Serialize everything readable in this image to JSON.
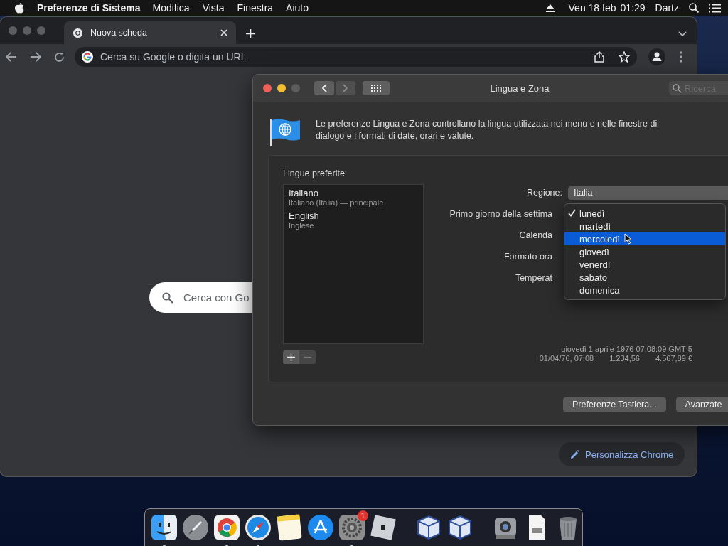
{
  "menu_bar": {
    "app_name": "Preferenze di Sistema",
    "menus": [
      "Modifica",
      "Vista",
      "Finestra",
      "Aiuto"
    ],
    "date": "Ven 18 feb",
    "time": "01:29",
    "user": "Dartz"
  },
  "browser": {
    "tab": {
      "title": "Nuova scheda"
    },
    "address_bar": {
      "placeholder": "Cerca su Google o digita un URL"
    },
    "search_box": {
      "placeholder": "Cerca con Go"
    },
    "customize_button": "Personalizza Chrome"
  },
  "prefs_window": {
    "title": "Lingua e Zona",
    "search": {
      "placeholder": "Ricerca"
    },
    "description": "Le preferenze Lingua e Zona controllano la lingua utilizzata nei menu e nelle finestre di dialogo e i formati di date, orari e valute.",
    "languages_label": "Lingue preferite:",
    "languages": [
      {
        "name": "Italiano",
        "detail": "Italiano (Italia) — principale"
      },
      {
        "name": "English",
        "detail": "Inglese"
      }
    ],
    "fields": [
      {
        "label": "Regione:",
        "value": "Italia"
      },
      {
        "label": "Primo giorno della settima"
      },
      {
        "label": "Calenda"
      },
      {
        "label": "Formato ora"
      },
      {
        "label": "Temperat"
      }
    ],
    "popup_menu": [
      {
        "label": "lunedì",
        "checked": true,
        "selected": false
      },
      {
        "label": "martedì",
        "checked": false,
        "selected": false
      },
      {
        "label": "mercoledì",
        "checked": false,
        "selected": true
      },
      {
        "label": "giovedì",
        "checked": false,
        "selected": false
      },
      {
        "label": "venerdì",
        "checked": false,
        "selected": false
      },
      {
        "label": "sabato",
        "checked": false,
        "selected": false
      },
      {
        "label": "domenica",
        "checked": false,
        "selected": false
      }
    ],
    "sample_date": "giovedì 1 aprile 1976 07:08:09 GMT-5",
    "samples": [
      "01/04/76, 07:08",
      "1.234,56",
      "4.567,89 €"
    ],
    "buttons": [
      "Preferenze Tastiera...",
      "Avanzate"
    ]
  },
  "dock": {
    "items": [
      {
        "kind": "finder",
        "running": true
      },
      {
        "kind": "launchpad",
        "running": false
      },
      {
        "kind": "chrome",
        "running": true
      },
      {
        "kind": "safari",
        "running": true
      },
      {
        "kind": "notes",
        "running": false
      },
      {
        "kind": "appstore",
        "running": false
      },
      {
        "kind": "settings",
        "running": true,
        "badge": "1"
      },
      {
        "kind": "roblox",
        "running": false
      },
      {
        "kind": "separator"
      },
      {
        "kind": "virtualbox",
        "running": false
      },
      {
        "kind": "virtualbox",
        "running": false
      },
      {
        "kind": "separator"
      },
      {
        "kind": "screenshot",
        "running": false
      },
      {
        "kind": "document",
        "running": false
      },
      {
        "kind": "trash",
        "running": false
      }
    ]
  }
}
